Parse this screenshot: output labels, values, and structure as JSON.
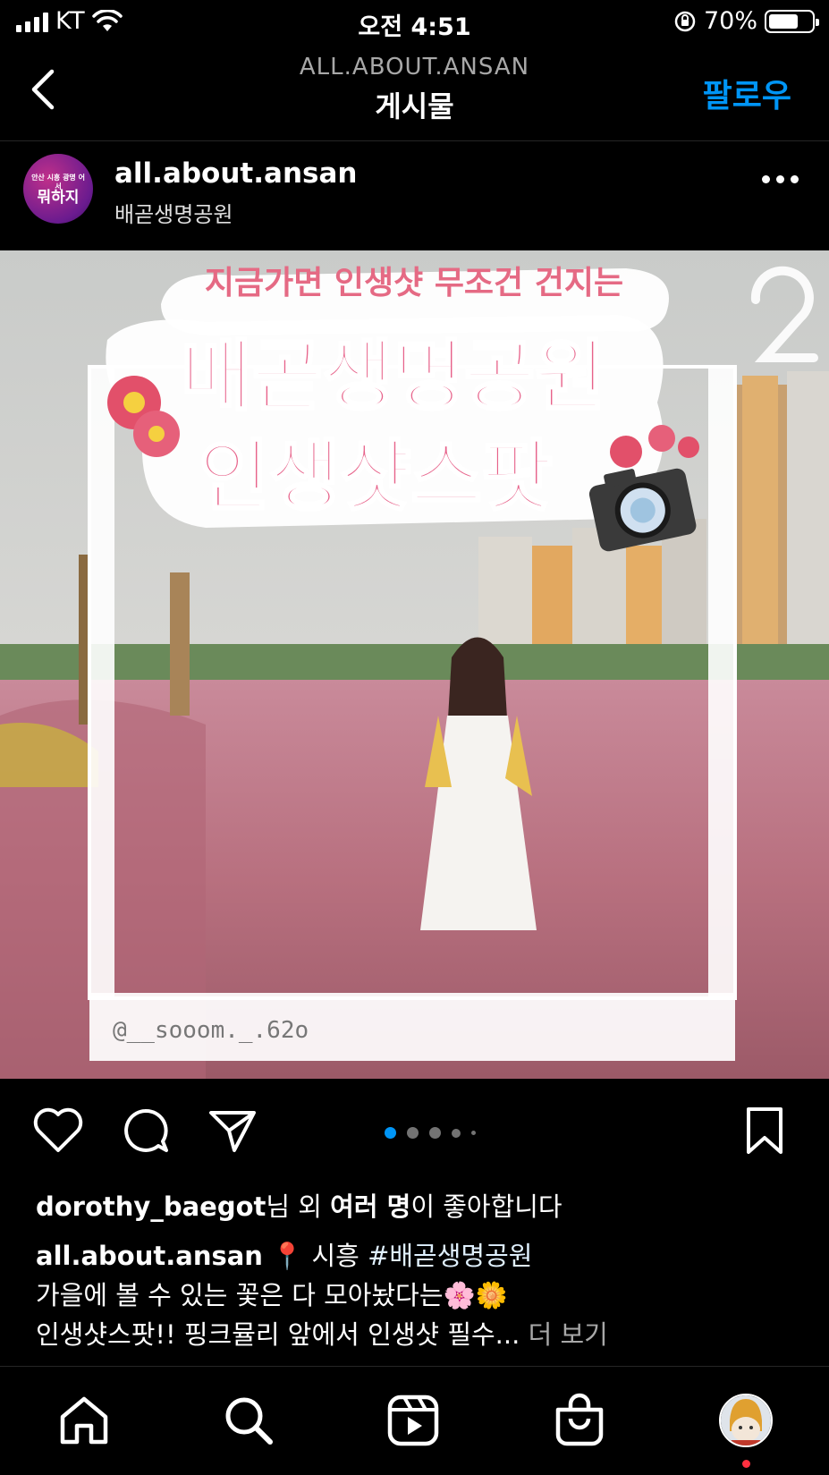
{
  "status_bar": {
    "carrier": "KT",
    "time": "오전 4:51",
    "battery_percent": "70%",
    "battery_level": 0.7
  },
  "nav": {
    "subtitle": "ALL.ABOUT.ANSAN",
    "title": "게시물",
    "follow_label": "팔로우"
  },
  "post": {
    "avatar_text_line1": "안산 시흥 광명 어서",
    "avatar_text_line2": "뭐하지",
    "username": "all.about.ansan",
    "location": "배곧생명공원",
    "image": {
      "headline_top": "지금가면 인생샷 무조건 건지는",
      "headline_main": "배곧생명공원",
      "headline_sub": "인생샷스팟",
      "photo_credit": "@__sooom._.62o"
    },
    "carousel": {
      "count": 5,
      "active_index": 0
    },
    "likes": {
      "user": "dorothy_baegot",
      "middle": "님 외 ",
      "others": "여러 명",
      "suffix": "이 좋아합니다"
    },
    "caption": {
      "username": "all.about.ansan",
      "line1_rest": " 📍 시흥 ",
      "hashtag": "#배곧생명공원",
      "line2": "가을에 볼 수 있는 꽃은 다 모아놨다는🌸🌼",
      "line3": "인생샷스팟!! 핑크뮬리 앞에서 인생샷 필수... ",
      "more_label": "더 보기"
    }
  },
  "colors": {
    "accent_blue": "#0095f6",
    "notification_red": "#ff3040",
    "dot_active": "#0095f6",
    "dot_inactive": "#737373"
  },
  "icons": {
    "nav": [
      "back-icon"
    ],
    "actions": [
      "heart-icon",
      "comment-icon",
      "share-icon",
      "bookmark-icon"
    ],
    "tabs": [
      "home-icon",
      "search-icon",
      "reels-icon",
      "shop-icon",
      "profile-avatar"
    ]
  }
}
